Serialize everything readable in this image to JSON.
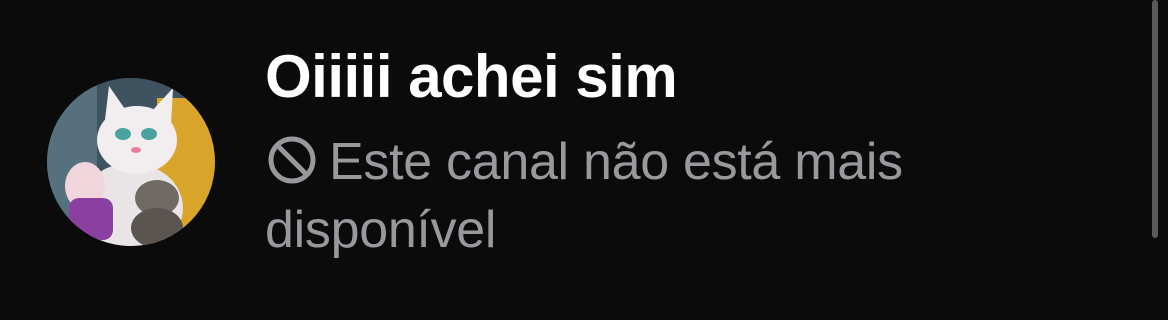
{
  "conversation": {
    "title": "Oiiiii achei sim",
    "status_text": "Este canal não está mais disponível",
    "status_icon": "blocked-icon",
    "colors": {
      "background": "#0b0b0c",
      "title": "#ffffff",
      "status": "#98989d"
    }
  }
}
